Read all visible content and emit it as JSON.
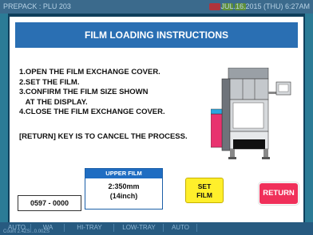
{
  "background": {
    "header_left": "PREPACK : PLU 203",
    "header_right": "JUL.16.2015 (THU)  6:27AM",
    "tabs": [
      "AUTO",
      "WA",
      "HI-TRAY",
      "LOW-TRAY",
      "AUTO"
    ],
    "status": "Count 2.4ZS...0.00ZS"
  },
  "dialog": {
    "title": "FILM LOADING INSTRUCTIONS",
    "steps": [
      "1.OPEN THE FILM EXCHANGE COVER.",
      "2.SET THE FILM.",
      "3.CONFIRM THE FILM SIZE SHOWN",
      "   AT THE DISPLAY.",
      "4.CLOSE THE FILM EXCHANGE COVER."
    ],
    "cancel_note": "[RETURN] KEY IS TO CANCEL THE PROCESS.",
    "code": "0597 - 0000",
    "upper_film": {
      "header": "UPPER FILM",
      "size_mm": "2:350mm",
      "size_inch": "(14inch)"
    },
    "set_film_label_1": "SET",
    "set_film_label_2": "FILM",
    "return_label": "RETURN"
  },
  "colors": {
    "title_bar": "#2a6fb3",
    "set_film": "#ffef2b",
    "return": "#f0305a",
    "upper_film_header": "#1f6dc2"
  }
}
